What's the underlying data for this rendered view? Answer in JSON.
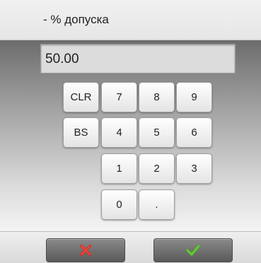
{
  "header": {
    "title": "- % допуска"
  },
  "display": {
    "value": "50.00"
  },
  "keypad": {
    "clr": "CLR",
    "bs": "BS",
    "k7": "7",
    "k8": "8",
    "k9": "9",
    "k4": "4",
    "k5": "5",
    "k6": "6",
    "k1": "1",
    "k2": "2",
    "k3": "3",
    "k0": "0",
    "kdot": "."
  },
  "footer": {
    "cancel_icon": "cancel-x-icon",
    "confirm_icon": "check-icon"
  },
  "colors": {
    "cancel_red": "#d03028",
    "confirm_green": "#4fb320"
  }
}
